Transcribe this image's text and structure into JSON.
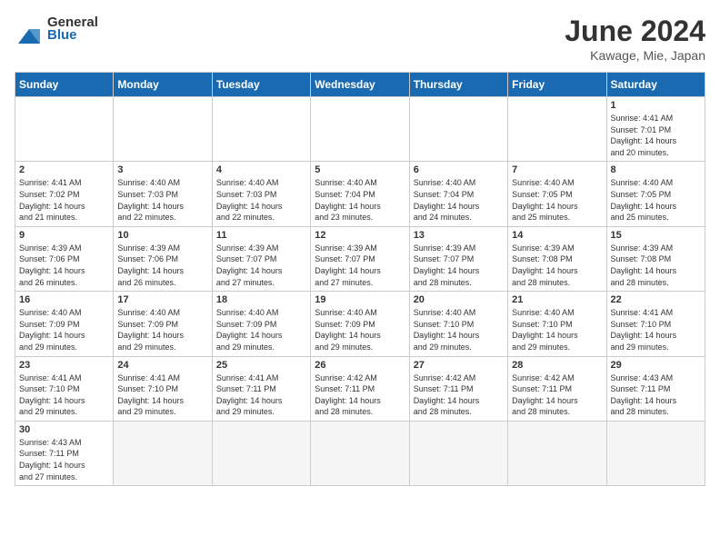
{
  "header": {
    "logo_general": "General",
    "logo_blue": "Blue",
    "month_year": "June 2024",
    "location": "Kawage, Mie, Japan"
  },
  "weekdays": [
    "Sunday",
    "Monday",
    "Tuesday",
    "Wednesday",
    "Thursday",
    "Friday",
    "Saturday"
  ],
  "weeks": [
    [
      {
        "day": "",
        "info": "",
        "empty": true
      },
      {
        "day": "",
        "info": "",
        "empty": true
      },
      {
        "day": "",
        "info": "",
        "empty": true
      },
      {
        "day": "",
        "info": "",
        "empty": true
      },
      {
        "day": "",
        "info": "",
        "empty": true
      },
      {
        "day": "",
        "info": "",
        "empty": true
      },
      {
        "day": "1",
        "info": "Sunrise: 4:41 AM\nSunset: 7:01 PM\nDaylight: 14 hours\nand 20 minutes."
      }
    ],
    [
      {
        "day": "2",
        "info": "Sunrise: 4:41 AM\nSunset: 7:02 PM\nDaylight: 14 hours\nand 21 minutes."
      },
      {
        "day": "3",
        "info": "Sunrise: 4:40 AM\nSunset: 7:03 PM\nDaylight: 14 hours\nand 22 minutes."
      },
      {
        "day": "4",
        "info": "Sunrise: 4:40 AM\nSunset: 7:03 PM\nDaylight: 14 hours\nand 22 minutes."
      },
      {
        "day": "5",
        "info": "Sunrise: 4:40 AM\nSunset: 7:04 PM\nDaylight: 14 hours\nand 23 minutes."
      },
      {
        "day": "6",
        "info": "Sunrise: 4:40 AM\nSunset: 7:04 PM\nDaylight: 14 hours\nand 24 minutes."
      },
      {
        "day": "7",
        "info": "Sunrise: 4:40 AM\nSunset: 7:05 PM\nDaylight: 14 hours\nand 25 minutes."
      },
      {
        "day": "8",
        "info": "Sunrise: 4:40 AM\nSunset: 7:05 PM\nDaylight: 14 hours\nand 25 minutes."
      }
    ],
    [
      {
        "day": "9",
        "info": "Sunrise: 4:39 AM\nSunset: 7:06 PM\nDaylight: 14 hours\nand 26 minutes."
      },
      {
        "day": "10",
        "info": "Sunrise: 4:39 AM\nSunset: 7:06 PM\nDaylight: 14 hours\nand 26 minutes."
      },
      {
        "day": "11",
        "info": "Sunrise: 4:39 AM\nSunset: 7:07 PM\nDaylight: 14 hours\nand 27 minutes."
      },
      {
        "day": "12",
        "info": "Sunrise: 4:39 AM\nSunset: 7:07 PM\nDaylight: 14 hours\nand 27 minutes."
      },
      {
        "day": "13",
        "info": "Sunrise: 4:39 AM\nSunset: 7:07 PM\nDaylight: 14 hours\nand 28 minutes."
      },
      {
        "day": "14",
        "info": "Sunrise: 4:39 AM\nSunset: 7:08 PM\nDaylight: 14 hours\nand 28 minutes."
      },
      {
        "day": "15",
        "info": "Sunrise: 4:39 AM\nSunset: 7:08 PM\nDaylight: 14 hours\nand 28 minutes."
      }
    ],
    [
      {
        "day": "16",
        "info": "Sunrise: 4:40 AM\nSunset: 7:09 PM\nDaylight: 14 hours\nand 29 minutes."
      },
      {
        "day": "17",
        "info": "Sunrise: 4:40 AM\nSunset: 7:09 PM\nDaylight: 14 hours\nand 29 minutes."
      },
      {
        "day": "18",
        "info": "Sunrise: 4:40 AM\nSunset: 7:09 PM\nDaylight: 14 hours\nand 29 minutes."
      },
      {
        "day": "19",
        "info": "Sunrise: 4:40 AM\nSunset: 7:09 PM\nDaylight: 14 hours\nand 29 minutes."
      },
      {
        "day": "20",
        "info": "Sunrise: 4:40 AM\nSunset: 7:10 PM\nDaylight: 14 hours\nand 29 minutes."
      },
      {
        "day": "21",
        "info": "Sunrise: 4:40 AM\nSunset: 7:10 PM\nDaylight: 14 hours\nand 29 minutes."
      },
      {
        "day": "22",
        "info": "Sunrise: 4:41 AM\nSunset: 7:10 PM\nDaylight: 14 hours\nand 29 minutes."
      }
    ],
    [
      {
        "day": "23",
        "info": "Sunrise: 4:41 AM\nSunset: 7:10 PM\nDaylight: 14 hours\nand 29 minutes."
      },
      {
        "day": "24",
        "info": "Sunrise: 4:41 AM\nSunset: 7:10 PM\nDaylight: 14 hours\nand 29 minutes."
      },
      {
        "day": "25",
        "info": "Sunrise: 4:41 AM\nSunset: 7:11 PM\nDaylight: 14 hours\nand 29 minutes."
      },
      {
        "day": "26",
        "info": "Sunrise: 4:42 AM\nSunset: 7:11 PM\nDaylight: 14 hours\nand 28 minutes."
      },
      {
        "day": "27",
        "info": "Sunrise: 4:42 AM\nSunset: 7:11 PM\nDaylight: 14 hours\nand 28 minutes."
      },
      {
        "day": "28",
        "info": "Sunrise: 4:42 AM\nSunset: 7:11 PM\nDaylight: 14 hours\nand 28 minutes."
      },
      {
        "day": "29",
        "info": "Sunrise: 4:43 AM\nSunset: 7:11 PM\nDaylight: 14 hours\nand 28 minutes."
      }
    ],
    [
      {
        "day": "30",
        "info": "Sunrise: 4:43 AM\nSunset: 7:11 PM\nDaylight: 14 hours\nand 27 minutes.",
        "has_data": true
      },
      {
        "day": "",
        "info": "",
        "empty": true
      },
      {
        "day": "",
        "info": "",
        "empty": true
      },
      {
        "day": "",
        "info": "",
        "empty": true
      },
      {
        "day": "",
        "info": "",
        "empty": true
      },
      {
        "day": "",
        "info": "",
        "empty": true
      },
      {
        "day": "",
        "info": "",
        "empty": true
      }
    ]
  ]
}
